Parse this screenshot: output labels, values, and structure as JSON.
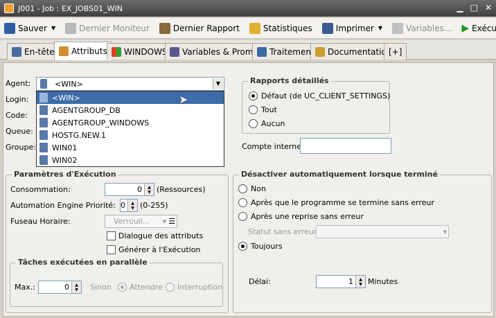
{
  "window": {
    "title": "J001 - Job : EX_JOBS01_WIN",
    "min": "▁",
    "max": "□",
    "close": "✕"
  },
  "toolbar": {
    "save": "Sauver",
    "monitor": "Dernier Moniteur",
    "report": "Dernier Rapport",
    "stats": "Statistiques",
    "print": "Imprimer",
    "variables": "Variables...",
    "execute": "Exécuter"
  },
  "tabs": [
    "En-tête",
    "Attributs",
    "WINDOWS",
    "Variables & Prompts",
    "Traitement",
    "Documentation"
  ],
  "tab_add": "[+]",
  "form": {
    "agent_label": "Agent:",
    "agent_value": "<WIN>",
    "login_label": "Login:",
    "code_label": "Code:",
    "queue_label": "Queue:",
    "group_label": "Groupe:"
  },
  "agent_options": [
    "<WIN>",
    "AGENTGROUP_DB",
    "AGENTGROUP_WINDOWS",
    "HOSTG.NEW.1",
    "WIN01",
    "WIN02"
  ],
  "reports": {
    "title": "Rapports détaillés",
    "options": [
      "Défaut (de UC_CLIENT_SETTINGS)",
      "Tout",
      "Aucun"
    ],
    "selected": 0,
    "internal_account": "Compte interne:"
  },
  "exec_params": {
    "title": "Paramètres d'Exécution",
    "consumption": "Consommation:",
    "consumption_value": "0",
    "consumption_unit": "(Ressources)",
    "priority": "Automation Engine Priorité:",
    "priority_value": "0",
    "priority_range": "(0-255)",
    "timezone": "Fuseau Horaire:",
    "timezone_value": "Verrouil...",
    "attr_dialog": "Dialogue des attributs",
    "gen_exec": "Générer à l'Exécution"
  },
  "parallel": {
    "title": "Tâches exécutées en parallèle",
    "max": "Max.:",
    "max_value": "0",
    "else": "Sinon",
    "wait": "Attendre",
    "abort": "Interruption"
  },
  "deactivate": {
    "title": "Désactiver automatiquement lorsque terminé",
    "options": [
      "Non",
      "Après que le programme se termine sans erreur",
      "Après une reprise sans erreur"
    ],
    "status_label": "Statut sans erreur:",
    "always": "Toujours",
    "delay": "Délai:",
    "delay_value": "1",
    "minutes": "Minutes"
  }
}
